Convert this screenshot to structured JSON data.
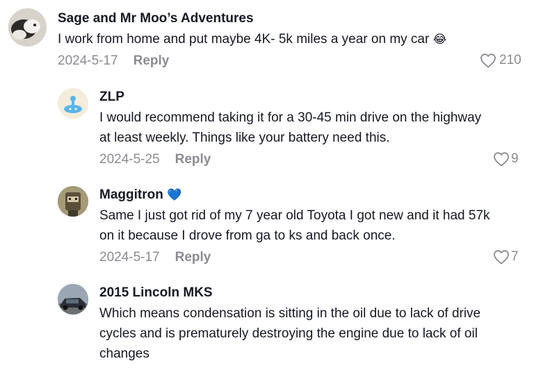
{
  "comments": [
    {
      "username": "Sage and Mr Moo’s Adventures",
      "text": "I work from home and put maybe 4K- 5k miles a year on my car",
      "emoji": "😂",
      "date": "2024-5-17",
      "reply_label": "Reply",
      "likes": "210"
    },
    {
      "username": "ZLP",
      "text_lines": [
        "I would recommend taking it for a 30-45 min drive on the highway",
        "at least weekly. Things like your battery need this."
      ],
      "date": "2024-5-25",
      "reply_label": "Reply",
      "likes": "9"
    },
    {
      "username": "Maggitron",
      "username_emoji": "💙",
      "text_lines": [
        "Same I just got rid of my 7 year old Toyota I got new and it had 57k",
        "on it because I drove from ga to ks and back once."
      ],
      "date": "2024-5-17",
      "reply_label": "Reply",
      "likes": "7"
    },
    {
      "username": "2015 Lincoln MKS",
      "text_lines": [
        "Which means condensation is sitting in the oil due to lack of drive",
        "cycles and is prematurely destroying the engine due to lack of oil",
        "changes"
      ]
    }
  ],
  "colors": {
    "text": "#161823",
    "meta": "#8a8b91",
    "background": "#ffffff"
  }
}
